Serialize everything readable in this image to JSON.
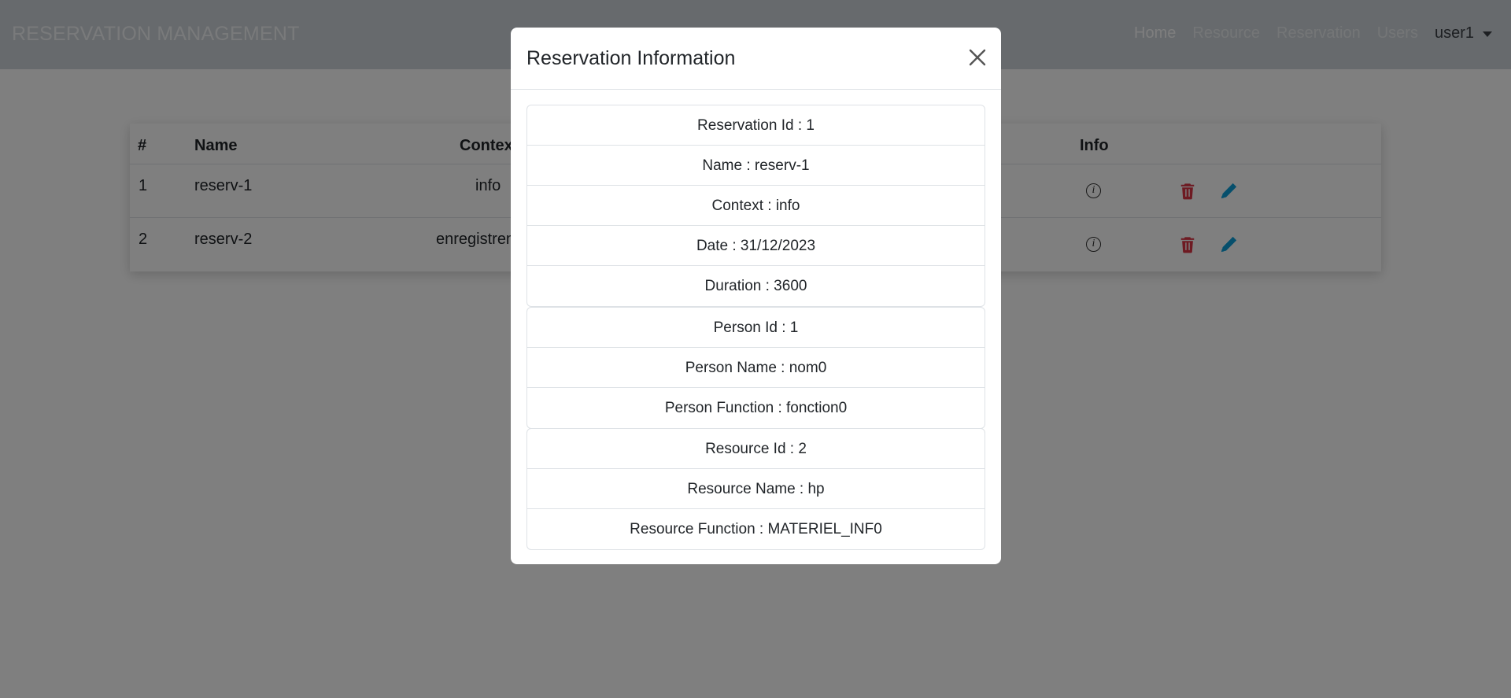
{
  "navbar": {
    "brand": "RESERVATION MANAGEMENT",
    "links": [
      "Home",
      "Resource",
      "Reservation",
      "Users"
    ],
    "user": "user1"
  },
  "table": {
    "headers": [
      "#",
      "Name",
      "Contex",
      "Info"
    ],
    "rows": [
      {
        "num": "1",
        "name": "reserv-1",
        "context": "info"
      },
      {
        "num": "2",
        "name": "reserv-2",
        "context": "enregistrem"
      }
    ]
  },
  "modal": {
    "title": "Reservation Information",
    "reservation": [
      "Reservation Id : 1",
      "Name : reserv-1",
      "Context : info",
      "Date : 31/12/2023",
      "Duration : 3600"
    ],
    "person": [
      "Person Id : 1",
      "Person Name : nom0",
      "Person Function : fonction0"
    ],
    "resource": [
      "Resource Id : 2",
      "Resource Name : hp",
      "Resource Function : MATERIEL_INF0"
    ]
  },
  "colors": {
    "delete": "#dc3545",
    "edit": "#0d9fd8",
    "backdrop": "rgba(0,0,0,0.5)"
  },
  "icons": [
    "info-icon",
    "trash-icon",
    "pencil-icon",
    "close-icon",
    "caret-down-icon"
  ]
}
